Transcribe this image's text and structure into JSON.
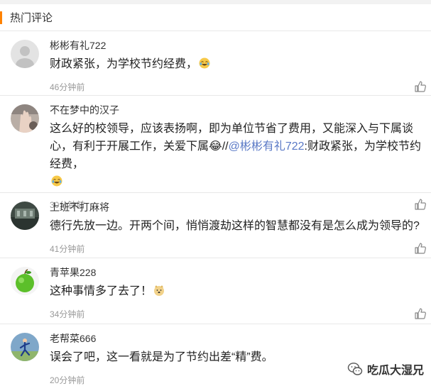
{
  "header": {
    "title": "热门评论",
    "accent_color": "#ff8200"
  },
  "comments": [
    {
      "user": "彬彬有礼722",
      "text_before": "财政紧张，为学校节约经费，",
      "mention": "",
      "text_after": "",
      "emoji": "laugh-cry",
      "time": "46分钟前",
      "avatar": "gray-default-avatar"
    },
    {
      "user": "不在梦中的汉子",
      "text_before": "这么好的校领导，应该表扬啊，即为单位节省了费用，又能深入与下属谈心，有利于开展工作，关爱下属😂//",
      "mention": "@彬彬有礼722",
      "text_after": ":财政紧张，为学校节约经费，",
      "emoji": "laugh-cry",
      "time": "30分钟前",
      "avatar": "hand-photo-avatar"
    },
    {
      "user": "上班不打麻将",
      "text_before": "德行先放一边。开两个间，悄悄渡劫这样的智慧都没有是怎么成为领导的?",
      "mention": "",
      "text_after": "",
      "emoji": "",
      "time": "41分钟前",
      "avatar": "building-photo-avatar"
    },
    {
      "user": "青苹果228",
      "text_before": "这种事情多了去了！",
      "mention": "",
      "text_after": "",
      "emoji": "doge",
      "time": "34分钟前",
      "avatar": "green-apple-avatar"
    },
    {
      "user": "老帮菜666",
      "text_before": "误会了吧，这一看就是为了节约出差“精”费。",
      "mention": "",
      "text_after": "",
      "emoji": "",
      "time": "20分钟前",
      "avatar": "runner-photo-avatar"
    }
  ],
  "watermark": {
    "text": "吃瓜大湿兄",
    "icon": "wechat-icon"
  }
}
